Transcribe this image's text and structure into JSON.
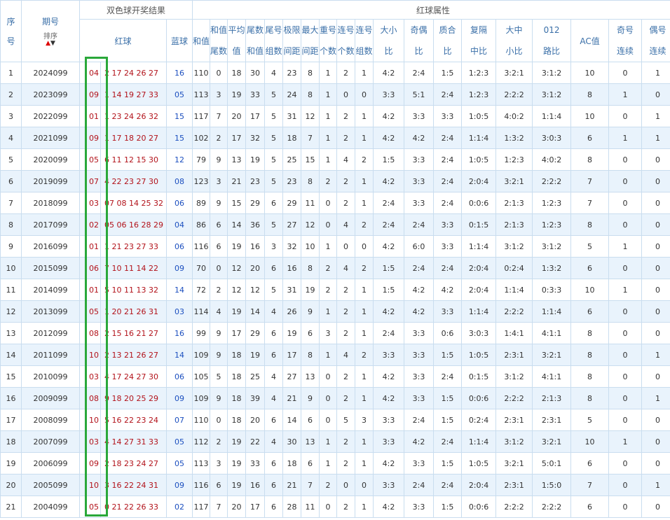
{
  "header": {
    "seq": "序号",
    "period": "期号",
    "sort": "排序",
    "draw_group": "双色球开奖结果",
    "attr_group": "红球属性",
    "red": "红球",
    "blue": "蓝球",
    "sum": "和值",
    "sum_tail": "和值尾数",
    "avg": "平均值",
    "tail_sum": "尾数和值",
    "tail_group": "尾号组数",
    "range": "极限间距",
    "max_gap": "最大间距",
    "repeat": "重号个数",
    "consec": "连号个数",
    "consec_group": "连号组数",
    "big_small": "大小比",
    "odd_even": "奇偶比",
    "prime_comp": "质合比",
    "skip": "复隔中比",
    "bms": "大中小比",
    "road": "012路比",
    "ac": "AC值",
    "odd_run": "奇号连续",
    "even_run": "偶号连续"
  },
  "rows": [
    {
      "seq": "1",
      "period": "2024099",
      "r1": "04",
      "reds": "2 17 24 26 27",
      "blue": "16",
      "sum": "110",
      "st": "0",
      "avg": "18",
      "ts": "30",
      "tg": "4",
      "rng": "23",
      "mg": "8",
      "rep": "1",
      "cn": "2",
      "cg": "1",
      "bs": "4:2",
      "oe": "2:4",
      "pc": "1:5",
      "sk": "1:2:3",
      "bm": "3:2:1",
      "rd": "3:1:2",
      "ac": "10",
      "or": "0",
      "er": "1"
    },
    {
      "seq": "2",
      "period": "2023099",
      "r1": "09",
      "reds": "1 14 19 27 33",
      "blue": "05",
      "sum": "113",
      "st": "3",
      "avg": "19",
      "ts": "33",
      "tg": "5",
      "rng": "24",
      "mg": "8",
      "rep": "1",
      "cn": "0",
      "cg": "0",
      "bs": "3:3",
      "oe": "5:1",
      "pc": "2:4",
      "sk": "1:2:3",
      "bm": "2:2:2",
      "rd": "3:1:2",
      "ac": "8",
      "or": "1",
      "er": "0"
    },
    {
      "seq": "3",
      "period": "2022099",
      "r1": "01",
      "reds": "1 23 24 26 32",
      "blue": "15",
      "sum": "117",
      "st": "7",
      "avg": "20",
      "ts": "17",
      "tg": "5",
      "rng": "31",
      "mg": "12",
      "rep": "1",
      "cn": "2",
      "cg": "1",
      "bs": "4:2",
      "oe": "3:3",
      "pc": "3:3",
      "sk": "1:0:5",
      "bm": "4:0:2",
      "rd": "1:1:4",
      "ac": "10",
      "or": "0",
      "er": "1"
    },
    {
      "seq": "4",
      "period": "2021099",
      "r1": "09",
      "reds": "1 17 18 20 27",
      "blue": "15",
      "sum": "102",
      "st": "2",
      "avg": "17",
      "ts": "32",
      "tg": "5",
      "rng": "18",
      "mg": "7",
      "rep": "1",
      "cn": "2",
      "cg": "1",
      "bs": "4:2",
      "oe": "4:2",
      "pc": "2:4",
      "sk": "1:1:4",
      "bm": "1:3:2",
      "rd": "3:0:3",
      "ac": "6",
      "or": "1",
      "er": "1"
    },
    {
      "seq": "5",
      "period": "2020099",
      "r1": "05",
      "reds": "6 11 12 15 30",
      "blue": "12",
      "sum": "79",
      "st": "9",
      "avg": "13",
      "ts": "19",
      "tg": "5",
      "rng": "25",
      "mg": "15",
      "rep": "1",
      "cn": "4",
      "cg": "2",
      "bs": "1:5",
      "oe": "3:3",
      "pc": "2:4",
      "sk": "1:0:5",
      "bm": "1:2:3",
      "rd": "4:0:2",
      "ac": "8",
      "or": "0",
      "er": "0"
    },
    {
      "seq": "6",
      "period": "2019099",
      "r1": "07",
      "reds": "4 22 23 27 30",
      "blue": "08",
      "sum": "123",
      "st": "3",
      "avg": "21",
      "ts": "23",
      "tg": "5",
      "rng": "23",
      "mg": "8",
      "rep": "2",
      "cn": "2",
      "cg": "1",
      "bs": "4:2",
      "oe": "3:3",
      "pc": "2:4",
      "sk": "2:0:4",
      "bm": "3:2:1",
      "rd": "2:2:2",
      "ac": "7",
      "or": "0",
      "er": "0"
    },
    {
      "seq": "7",
      "period": "2018099",
      "r1": "03",
      "reds": "07 08 14 25 32",
      "blue": "06",
      "sum": "89",
      "st": "9",
      "avg": "15",
      "ts": "29",
      "tg": "6",
      "rng": "29",
      "mg": "11",
      "rep": "0",
      "cn": "2",
      "cg": "1",
      "bs": "2:4",
      "oe": "3:3",
      "pc": "2:4",
      "sk": "0:0:6",
      "bm": "2:1:3",
      "rd": "1:2:3",
      "ac": "7",
      "or": "0",
      "er": "0"
    },
    {
      "seq": "8",
      "period": "2017099",
      "r1": "02",
      "reds": "05 06 16 28 29",
      "blue": "04",
      "sum": "86",
      "st": "6",
      "avg": "14",
      "ts": "36",
      "tg": "5",
      "rng": "27",
      "mg": "12",
      "rep": "0",
      "cn": "4",
      "cg": "2",
      "bs": "2:4",
      "oe": "2:4",
      "pc": "3:3",
      "sk": "0:1:5",
      "bm": "2:1:3",
      "rd": "1:2:3",
      "ac": "8",
      "or": "0",
      "er": "0"
    },
    {
      "seq": "9",
      "period": "2016099",
      "r1": "01",
      "reds": "1 21 23 27 33",
      "blue": "06",
      "sum": "116",
      "st": "6",
      "avg": "19",
      "ts": "16",
      "tg": "3",
      "rng": "32",
      "mg": "10",
      "rep": "1",
      "cn": "0",
      "cg": "0",
      "bs": "4:2",
      "oe": "6:0",
      "pc": "3:3",
      "sk": "1:1:4",
      "bm": "3:1:2",
      "rd": "3:1:2",
      "ac": "5",
      "or": "1",
      "er": "0"
    },
    {
      "seq": "10",
      "period": "2015099",
      "r1": "06",
      "reds": "7 10 11 14 22",
      "blue": "09",
      "sum": "70",
      "st": "0",
      "avg": "12",
      "ts": "20",
      "tg": "6",
      "rng": "16",
      "mg": "8",
      "rep": "2",
      "cn": "4",
      "cg": "2",
      "bs": "1:5",
      "oe": "2:4",
      "pc": "2:4",
      "sk": "2:0:4",
      "bm": "0:2:4",
      "rd": "1:3:2",
      "ac": "6",
      "or": "0",
      "er": "0"
    },
    {
      "seq": "11",
      "period": "2014099",
      "r1": "01",
      "reds": "5 10 11 13 32",
      "blue": "14",
      "sum": "72",
      "st": "2",
      "avg": "12",
      "ts": "12",
      "tg": "5",
      "rng": "31",
      "mg": "19",
      "rep": "2",
      "cn": "2",
      "cg": "1",
      "bs": "1:5",
      "oe": "4:2",
      "pc": "4:2",
      "sk": "2:0:4",
      "bm": "1:1:4",
      "rd": "0:3:3",
      "ac": "10",
      "or": "1",
      "er": "0"
    },
    {
      "seq": "12",
      "period": "2013099",
      "r1": "05",
      "reds": "1 20 21 26 31",
      "blue": "03",
      "sum": "114",
      "st": "4",
      "avg": "19",
      "ts": "14",
      "tg": "4",
      "rng": "26",
      "mg": "9",
      "rep": "1",
      "cn": "2",
      "cg": "1",
      "bs": "4:2",
      "oe": "4:2",
      "pc": "3:3",
      "sk": "1:1:4",
      "bm": "2:2:2",
      "rd": "1:1:4",
      "ac": "6",
      "or": "0",
      "er": "0"
    },
    {
      "seq": "13",
      "period": "2012099",
      "r1": "08",
      "reds": "2 15 16 21 27",
      "blue": "16",
      "sum": "99",
      "st": "9",
      "avg": "17",
      "ts": "29",
      "tg": "6",
      "rng": "19",
      "mg": "6",
      "rep": "3",
      "cn": "2",
      "cg": "1",
      "bs": "2:4",
      "oe": "3:3",
      "pc": "0:6",
      "sk": "3:0:3",
      "bm": "1:4:1",
      "rd": "4:1:1",
      "ac": "8",
      "or": "0",
      "er": "0"
    },
    {
      "seq": "14",
      "period": "2011099",
      "r1": "10",
      "reds": "2 13 21 26 27",
      "blue": "14",
      "sum": "109",
      "st": "9",
      "avg": "18",
      "ts": "19",
      "tg": "6",
      "rng": "17",
      "mg": "8",
      "rep": "1",
      "cn": "4",
      "cg": "2",
      "bs": "3:3",
      "oe": "3:3",
      "pc": "1:5",
      "sk": "1:0:5",
      "bm": "2:3:1",
      "rd": "3:2:1",
      "ac": "8",
      "or": "0",
      "er": "1"
    },
    {
      "seq": "15",
      "period": "2010099",
      "r1": "03",
      "reds": "4 17 24 27 30",
      "blue": "06",
      "sum": "105",
      "st": "5",
      "avg": "18",
      "ts": "25",
      "tg": "4",
      "rng": "27",
      "mg": "13",
      "rep": "0",
      "cn": "2",
      "cg": "1",
      "bs": "4:2",
      "oe": "3:3",
      "pc": "2:4",
      "sk": "0:1:5",
      "bm": "3:1:2",
      "rd": "4:1:1",
      "ac": "8",
      "or": "0",
      "er": "0"
    },
    {
      "seq": "16",
      "period": "2009099",
      "r1": "08",
      "reds": "9 18 20 25 29",
      "blue": "09",
      "sum": "109",
      "st": "9",
      "avg": "18",
      "ts": "39",
      "tg": "4",
      "rng": "21",
      "mg": "9",
      "rep": "0",
      "cn": "2",
      "cg": "1",
      "bs": "4:2",
      "oe": "3:3",
      "pc": "1:5",
      "sk": "0:0:6",
      "bm": "2:2:2",
      "rd": "2:1:3",
      "ac": "8",
      "or": "0",
      "er": "1"
    },
    {
      "seq": "17",
      "period": "2008099",
      "r1": "10",
      "reds": "5 16 22 23 24",
      "blue": "07",
      "sum": "110",
      "st": "0",
      "avg": "18",
      "ts": "20",
      "tg": "6",
      "rng": "14",
      "mg": "6",
      "rep": "0",
      "cn": "5",
      "cg": "3",
      "bs": "3:3",
      "oe": "2:4",
      "pc": "1:5",
      "sk": "0:2:4",
      "bm": "2:3:1",
      "rd": "2:3:1",
      "ac": "5",
      "or": "0",
      "er": "0"
    },
    {
      "seq": "18",
      "period": "2007099",
      "r1": "03",
      "reds": "4 14 27 31 33",
      "blue": "05",
      "sum": "112",
      "st": "2",
      "avg": "19",
      "ts": "22",
      "tg": "4",
      "rng": "30",
      "mg": "13",
      "rep": "1",
      "cn": "2",
      "cg": "1",
      "bs": "3:3",
      "oe": "4:2",
      "pc": "2:4",
      "sk": "1:1:4",
      "bm": "3:1:2",
      "rd": "3:2:1",
      "ac": "10",
      "or": "1",
      "er": "0"
    },
    {
      "seq": "19",
      "period": "2006099",
      "r1": "09",
      "reds": "2 18 23 24 27",
      "blue": "05",
      "sum": "113",
      "st": "3",
      "avg": "19",
      "ts": "33",
      "tg": "6",
      "rng": "18",
      "mg": "6",
      "rep": "1",
      "cn": "2",
      "cg": "1",
      "bs": "4:2",
      "oe": "3:3",
      "pc": "1:5",
      "sk": "1:0:5",
      "bm": "3:2:1",
      "rd": "5:0:1",
      "ac": "6",
      "or": "0",
      "er": "0"
    },
    {
      "seq": "20",
      "period": "2005099",
      "r1": "10",
      "reds": "3 16 22 24 31",
      "blue": "09",
      "sum": "116",
      "st": "6",
      "avg": "19",
      "ts": "16",
      "tg": "6",
      "rng": "21",
      "mg": "7",
      "rep": "2",
      "cn": "0",
      "cg": "0",
      "bs": "3:3",
      "oe": "2:4",
      "pc": "2:4",
      "sk": "2:0:4",
      "bm": "2:3:1",
      "rd": "1:5:0",
      "ac": "7",
      "or": "0",
      "er": "1"
    },
    {
      "seq": "21",
      "period": "2004099",
      "r1": "05",
      "reds": "0 21 22 26 33",
      "blue": "02",
      "sum": "117",
      "st": "7",
      "avg": "20",
      "ts": "17",
      "tg": "6",
      "rng": "28",
      "mg": "11",
      "rep": "0",
      "cn": "2",
      "cg": "1",
      "bs": "4:2",
      "oe": "3:3",
      "pc": "1:5",
      "sk": "0:0:6",
      "bm": "2:2:2",
      "rd": "2:2:2",
      "ac": "6",
      "or": "0",
      "er": "0"
    }
  ],
  "colors": {
    "highlight_box": "#2aa83a",
    "red_ball": "#b2121a",
    "blue_ball": "#1c4fbf",
    "stripe": "#e9f3fc",
    "border": "#c9ddef"
  }
}
